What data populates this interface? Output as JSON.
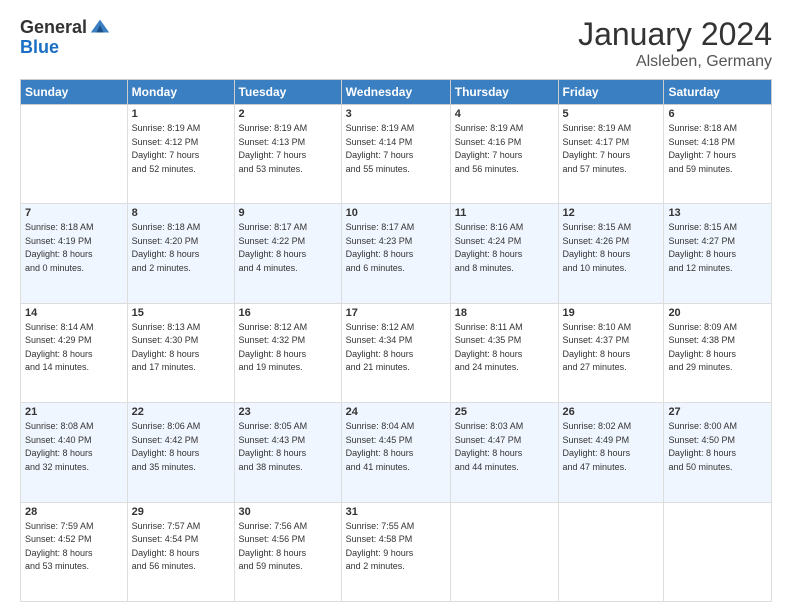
{
  "header": {
    "logo_general": "General",
    "logo_blue": "Blue",
    "month": "January 2024",
    "location": "Alsleben, Germany"
  },
  "weekdays": [
    "Sunday",
    "Monday",
    "Tuesday",
    "Wednesday",
    "Thursday",
    "Friday",
    "Saturday"
  ],
  "weeks": [
    [
      {
        "day": "",
        "info": ""
      },
      {
        "day": "1",
        "info": "Sunrise: 8:19 AM\nSunset: 4:12 PM\nDaylight: 7 hours\nand 52 minutes."
      },
      {
        "day": "2",
        "info": "Sunrise: 8:19 AM\nSunset: 4:13 PM\nDaylight: 7 hours\nand 53 minutes."
      },
      {
        "day": "3",
        "info": "Sunrise: 8:19 AM\nSunset: 4:14 PM\nDaylight: 7 hours\nand 55 minutes."
      },
      {
        "day": "4",
        "info": "Sunrise: 8:19 AM\nSunset: 4:16 PM\nDaylight: 7 hours\nand 56 minutes."
      },
      {
        "day": "5",
        "info": "Sunrise: 8:19 AM\nSunset: 4:17 PM\nDaylight: 7 hours\nand 57 minutes."
      },
      {
        "day": "6",
        "info": "Sunrise: 8:18 AM\nSunset: 4:18 PM\nDaylight: 7 hours\nand 59 minutes."
      }
    ],
    [
      {
        "day": "7",
        "info": "Sunrise: 8:18 AM\nSunset: 4:19 PM\nDaylight: 8 hours\nand 0 minutes."
      },
      {
        "day": "8",
        "info": "Sunrise: 8:18 AM\nSunset: 4:20 PM\nDaylight: 8 hours\nand 2 minutes."
      },
      {
        "day": "9",
        "info": "Sunrise: 8:17 AM\nSunset: 4:22 PM\nDaylight: 8 hours\nand 4 minutes."
      },
      {
        "day": "10",
        "info": "Sunrise: 8:17 AM\nSunset: 4:23 PM\nDaylight: 8 hours\nand 6 minutes."
      },
      {
        "day": "11",
        "info": "Sunrise: 8:16 AM\nSunset: 4:24 PM\nDaylight: 8 hours\nand 8 minutes."
      },
      {
        "day": "12",
        "info": "Sunrise: 8:15 AM\nSunset: 4:26 PM\nDaylight: 8 hours\nand 10 minutes."
      },
      {
        "day": "13",
        "info": "Sunrise: 8:15 AM\nSunset: 4:27 PM\nDaylight: 8 hours\nand 12 minutes."
      }
    ],
    [
      {
        "day": "14",
        "info": "Sunrise: 8:14 AM\nSunset: 4:29 PM\nDaylight: 8 hours\nand 14 minutes."
      },
      {
        "day": "15",
        "info": "Sunrise: 8:13 AM\nSunset: 4:30 PM\nDaylight: 8 hours\nand 17 minutes."
      },
      {
        "day": "16",
        "info": "Sunrise: 8:12 AM\nSunset: 4:32 PM\nDaylight: 8 hours\nand 19 minutes."
      },
      {
        "day": "17",
        "info": "Sunrise: 8:12 AM\nSunset: 4:34 PM\nDaylight: 8 hours\nand 21 minutes."
      },
      {
        "day": "18",
        "info": "Sunrise: 8:11 AM\nSunset: 4:35 PM\nDaylight: 8 hours\nand 24 minutes."
      },
      {
        "day": "19",
        "info": "Sunrise: 8:10 AM\nSunset: 4:37 PM\nDaylight: 8 hours\nand 27 minutes."
      },
      {
        "day": "20",
        "info": "Sunrise: 8:09 AM\nSunset: 4:38 PM\nDaylight: 8 hours\nand 29 minutes."
      }
    ],
    [
      {
        "day": "21",
        "info": "Sunrise: 8:08 AM\nSunset: 4:40 PM\nDaylight: 8 hours\nand 32 minutes."
      },
      {
        "day": "22",
        "info": "Sunrise: 8:06 AM\nSunset: 4:42 PM\nDaylight: 8 hours\nand 35 minutes."
      },
      {
        "day": "23",
        "info": "Sunrise: 8:05 AM\nSunset: 4:43 PM\nDaylight: 8 hours\nand 38 minutes."
      },
      {
        "day": "24",
        "info": "Sunrise: 8:04 AM\nSunset: 4:45 PM\nDaylight: 8 hours\nand 41 minutes."
      },
      {
        "day": "25",
        "info": "Sunrise: 8:03 AM\nSunset: 4:47 PM\nDaylight: 8 hours\nand 44 minutes."
      },
      {
        "day": "26",
        "info": "Sunrise: 8:02 AM\nSunset: 4:49 PM\nDaylight: 8 hours\nand 47 minutes."
      },
      {
        "day": "27",
        "info": "Sunrise: 8:00 AM\nSunset: 4:50 PM\nDaylight: 8 hours\nand 50 minutes."
      }
    ],
    [
      {
        "day": "28",
        "info": "Sunrise: 7:59 AM\nSunset: 4:52 PM\nDaylight: 8 hours\nand 53 minutes."
      },
      {
        "day": "29",
        "info": "Sunrise: 7:57 AM\nSunset: 4:54 PM\nDaylight: 8 hours\nand 56 minutes."
      },
      {
        "day": "30",
        "info": "Sunrise: 7:56 AM\nSunset: 4:56 PM\nDaylight: 8 hours\nand 59 minutes."
      },
      {
        "day": "31",
        "info": "Sunrise: 7:55 AM\nSunset: 4:58 PM\nDaylight: 9 hours\nand 2 minutes."
      },
      {
        "day": "",
        "info": ""
      },
      {
        "day": "",
        "info": ""
      },
      {
        "day": "",
        "info": ""
      }
    ]
  ]
}
